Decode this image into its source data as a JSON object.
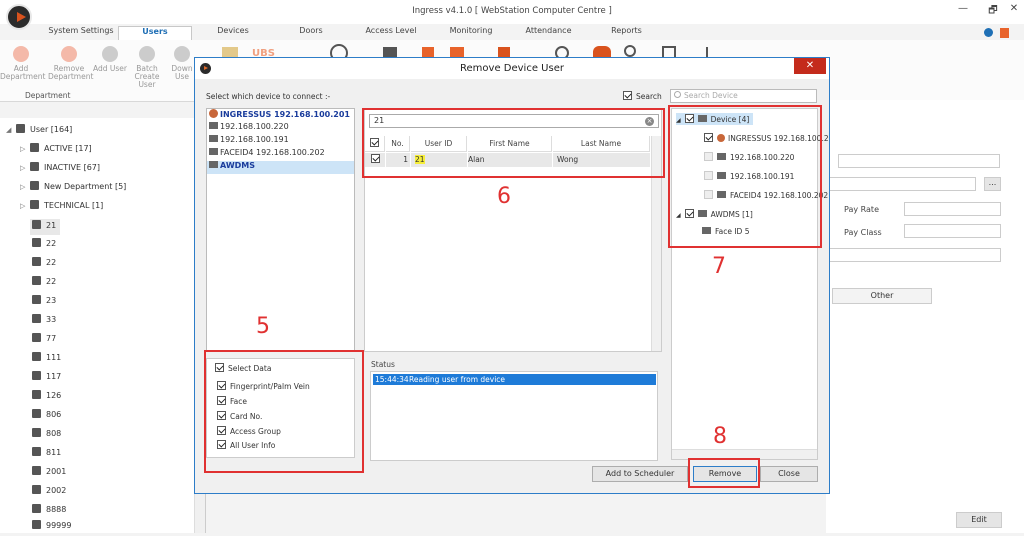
{
  "app": {
    "title": "Ingress v4.1.0 [ WebStation Computer Centre ]",
    "win_min": "—",
    "win_restore": "🗗",
    "win_close": "✕"
  },
  "tabs": [
    "System Settings",
    "Users",
    "Devices",
    "Doors",
    "Access Level",
    "Monitoring",
    "Attendance",
    "Reports"
  ],
  "ribbon": {
    "buttons": [
      "Add Department",
      "Remove Department",
      "Add User",
      "Batch Create User",
      "Down Use"
    ],
    "group_label": "Department",
    "ubs": "UBS"
  },
  "user_tree": {
    "root": "User [164]",
    "groups": [
      "ACTIVE [17]",
      "INACTIVE [67]",
      "New Department [5]",
      "TECHNICAL [1]"
    ],
    "users": [
      "21",
      "22",
      "22",
      "22",
      "23",
      "33",
      "77",
      "111",
      "117",
      "126",
      "806",
      "808",
      "811",
      "2001",
      "2002",
      "8888",
      "99999"
    ]
  },
  "right_panel": {
    "pay_rate": "Pay Rate",
    "pay_class": "Pay Class",
    "other_tab": "Other",
    "edit_button": "Edit",
    "browse": "..."
  },
  "dialog": {
    "title": "Remove Device User",
    "close": "✕",
    "select_prompt": "Select which device to connect :-",
    "search_label": "Search",
    "search_placeholder": "Search Device",
    "devices": [
      "INGRESSUS 192.168.100.201",
      "192.168.100.220",
      "192.168.100.191",
      "FACEID4 192.168.100.202",
      "AWDMS"
    ],
    "select_data": {
      "label": "Select Data",
      "items": [
        "Fingerprint/Palm Vein",
        "Face",
        "Card No.",
        "Access Group",
        "All User Info"
      ]
    },
    "grid": {
      "search_value": "21",
      "columns": [
        "No.",
        "User ID",
        "First Name",
        "Last Name"
      ],
      "rows": [
        {
          "no": "1",
          "user_id": "21",
          "first_name": "Alan",
          "last_name": "Wong"
        }
      ]
    },
    "status": {
      "label": "Status",
      "time": "15:44:34",
      "message": "Reading user from device"
    },
    "tree": {
      "device_root": "Device [4]",
      "device_children": [
        "INGRESSUS 192.168.100.2",
        "192.168.100.220",
        "192.168.100.191",
        "FACEID4 192.168.100.202"
      ],
      "awdms_root": "AWDMS [1]",
      "awdms_children": [
        "Face ID 5"
      ]
    },
    "buttons": {
      "scheduler": "Add to Scheduler",
      "remove": "Remove",
      "close": "Close"
    }
  },
  "callouts": [
    "5",
    "6",
    "7",
    "8"
  ],
  "colors": {
    "accent": "#1f6fb5",
    "highlight_red": "#e03131",
    "status_selection": "#1e7bd8"
  }
}
